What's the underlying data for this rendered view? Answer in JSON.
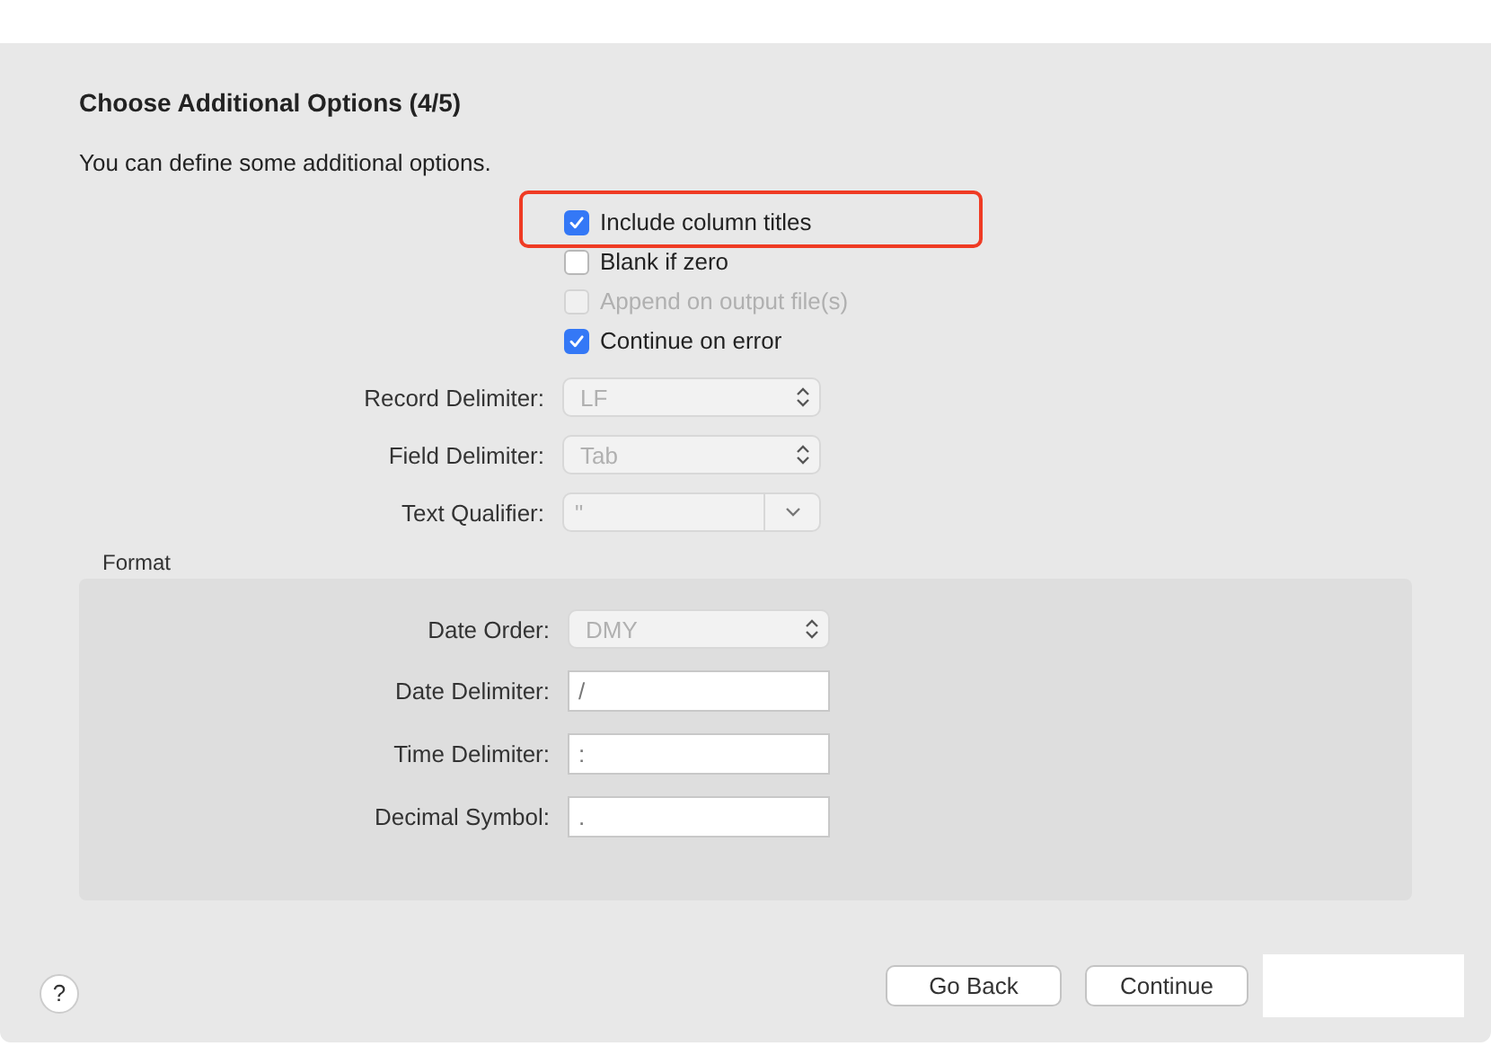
{
  "title": "Choose Additional Options (4/5)",
  "description": "You can define some additional options.",
  "options": [
    {
      "label": "Include column titles",
      "checked": true,
      "disabled": false,
      "highlighted": true
    },
    {
      "label": "Blank if zero",
      "checked": false,
      "disabled": false,
      "highlighted": false
    },
    {
      "label": "Append on output file(s)",
      "checked": false,
      "disabled": true,
      "highlighted": false
    },
    {
      "label": "Continue on error",
      "checked": true,
      "disabled": false,
      "highlighted": false
    }
  ],
  "delimiters": [
    {
      "label": "Record Delimiter:",
      "kind": "stepper",
      "value": "LF"
    },
    {
      "label": "Field Delimiter:",
      "kind": "stepper",
      "value": "Tab"
    },
    {
      "label": "Text Qualifier:",
      "kind": "combo",
      "value": "\""
    }
  ],
  "format": {
    "title": "Format",
    "fields": [
      {
        "label": "Date Order:",
        "kind": "stepper",
        "value": "DMY"
      },
      {
        "label": "Date Delimiter:",
        "kind": "text",
        "value": "/"
      },
      {
        "label": "Time Delimiter:",
        "kind": "text",
        "value": ":"
      },
      {
        "label": "Decimal Symbol:",
        "kind": "text",
        "value": "."
      }
    ]
  },
  "help": "?",
  "buttons": [
    "Go Back",
    "Continue"
  ]
}
